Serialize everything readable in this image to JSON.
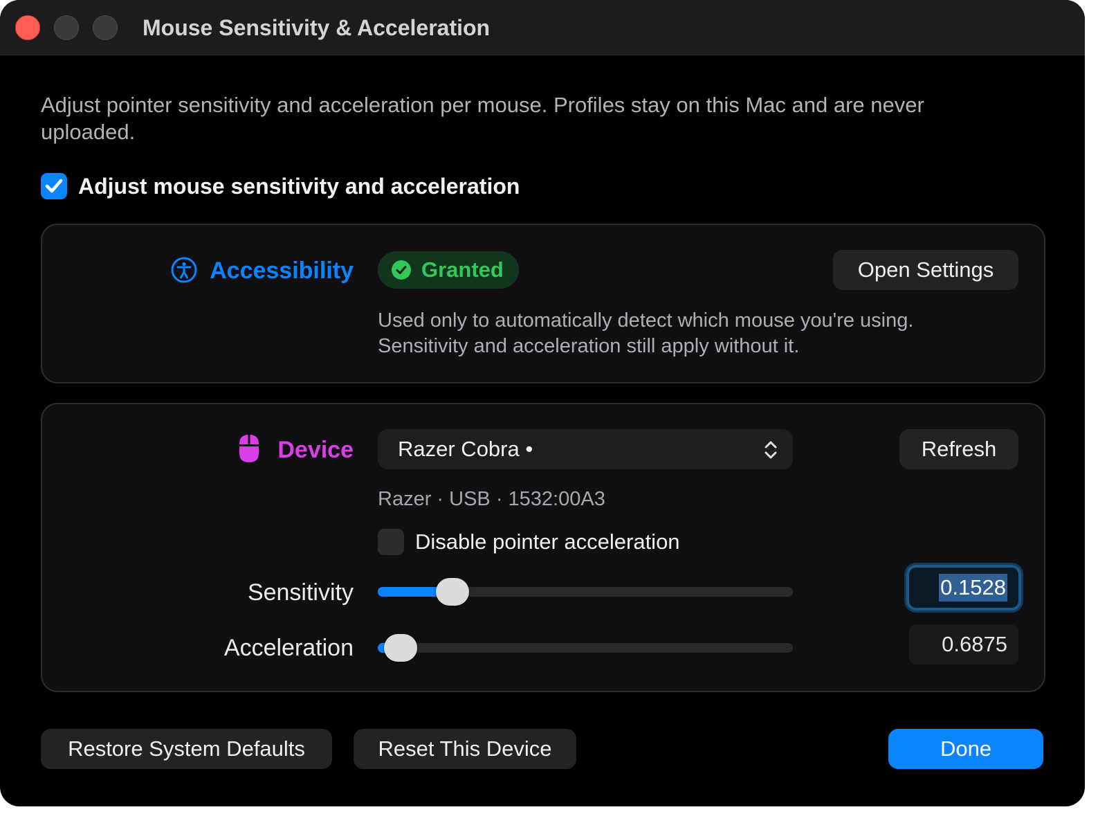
{
  "window": {
    "title": "Mouse Sensitivity & Acceleration"
  },
  "intro": "Adjust pointer sensitivity and acceleration per mouse. Profiles stay on this Mac and are never uploaded.",
  "master_toggle": {
    "label": "Adjust mouse sensitivity and acceleration",
    "checked": true
  },
  "accessibility": {
    "icon": "accessibility-icon",
    "label": "Accessibility",
    "status": "Granted",
    "status_icon": "checkmark-circle-icon",
    "open_settings_label": "Open Settings",
    "description": "Used only to automatically detect which mouse you're using. Sensitivity and acceleration still apply without it."
  },
  "device": {
    "icon": "mouse-icon",
    "label": "Device",
    "selected": "Razer Cobra •",
    "refresh_label": "Refresh",
    "meta": "Razer · USB · 1532:00A3",
    "disable_accel_label": "Disable pointer acceleration",
    "disable_accel_checked": false
  },
  "sensitivity": {
    "label": "Sensitivity",
    "value": "0.1528",
    "level": 0.18
  },
  "acceleration": {
    "label": "Acceleration",
    "value": "0.6875",
    "level": 0.055
  },
  "footer": {
    "restore_label": "Restore System Defaults",
    "reset_label": "Reset This Device",
    "done_label": "Done"
  },
  "colors": {
    "accent": "#0a84ff",
    "granted": "#34c759",
    "device": "#da3ee8",
    "close": "#ff5f57"
  }
}
